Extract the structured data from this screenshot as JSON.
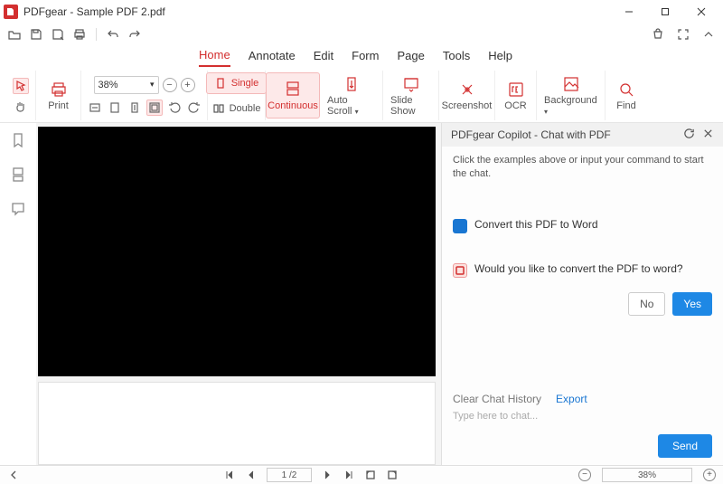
{
  "app": {
    "title": "PDFgear - Sample PDF 2.pdf"
  },
  "menu": {
    "home": "Home",
    "annotate": "Annotate",
    "edit": "Edit",
    "form": "Form",
    "page": "Page",
    "tools": "Tools",
    "help": "Help"
  },
  "toolbar": {
    "print": "Print",
    "zoom_value": "38%",
    "single": "Single",
    "double": "Double",
    "continuous": "Continuous",
    "auto_scroll": "Auto Scroll",
    "slide_show": "Slide Show",
    "screenshot": "Screenshot",
    "ocr": "OCR",
    "background": "Background",
    "find": "Find"
  },
  "copilot": {
    "title": "PDFgear Copilot - Chat with PDF",
    "hint": "Click the examples above or input your command to start the chat.",
    "msg_user": "Convert this PDF to Word",
    "msg_bot": "Would you like to convert the PDF to word?",
    "no": "No",
    "yes": "Yes",
    "clear": "Clear Chat History",
    "export": "Export",
    "placeholder": "Type here to chat...",
    "send": "Send"
  },
  "status": {
    "page": "1 /2",
    "zoom": "38%"
  }
}
